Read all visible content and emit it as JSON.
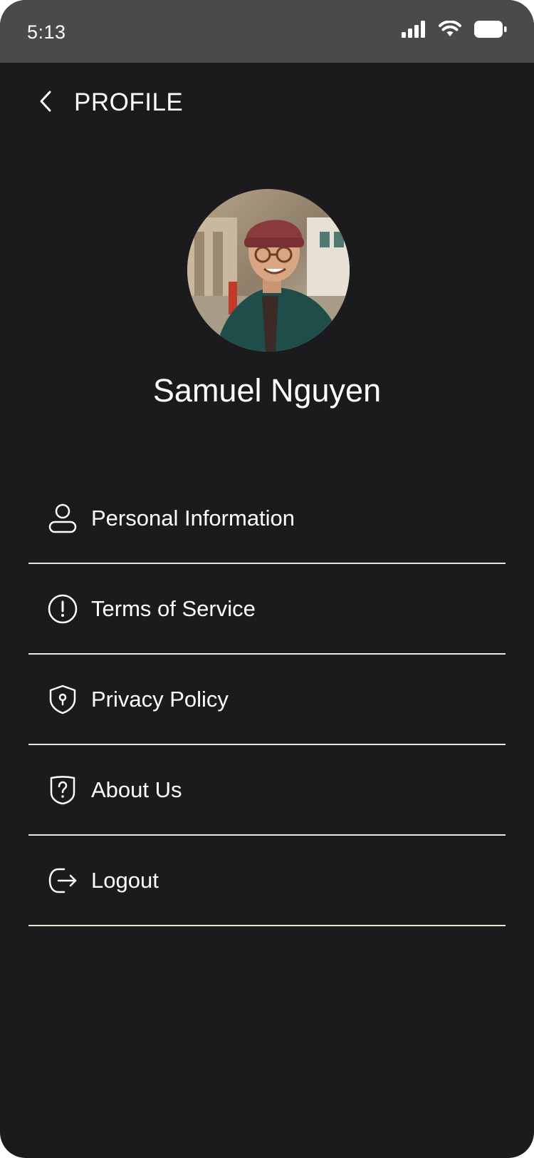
{
  "status_bar": {
    "time": "5:13",
    "signal_icon": "cellular-signal-icon",
    "wifi_icon": "wifi-icon",
    "battery_icon": "battery-icon"
  },
  "header": {
    "back_icon": "chevron-left-icon",
    "title": "PROFILE"
  },
  "profile": {
    "name": "Samuel Nguyen"
  },
  "menu": {
    "items": [
      {
        "label": "Personal Information",
        "icon": "user-icon"
      },
      {
        "label": "Terms of Service",
        "icon": "alert-circle-icon"
      },
      {
        "label": "Privacy Policy",
        "icon": "shield-lock-icon"
      },
      {
        "label": "About Us",
        "icon": "shield-question-icon"
      },
      {
        "label": "Logout",
        "icon": "logout-icon"
      }
    ]
  },
  "colors": {
    "background": "#1b1b1e",
    "status_bar": "#4a4a4c",
    "divider": "#f1e3da",
    "text": "#ffffff"
  }
}
